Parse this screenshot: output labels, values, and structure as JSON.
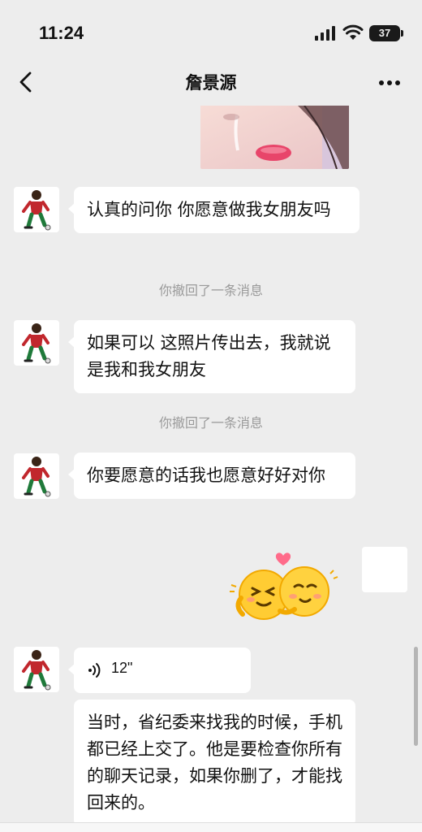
{
  "status_bar": {
    "time": "11:24",
    "battery": "37"
  },
  "nav": {
    "title": "詹景源"
  },
  "messages": [
    {
      "type": "text",
      "text": "认真的问你 你愿意做我女朋友吗"
    },
    {
      "type": "system",
      "text": "你撤回了一条消息"
    },
    {
      "type": "text",
      "text": "如果可以 这照片传出去，我就说是我和我女朋友"
    },
    {
      "type": "system",
      "text": "你撤回了一条消息"
    },
    {
      "type": "text",
      "text": "你要愿意的话我也愿意好好对你"
    },
    {
      "type": "sticker",
      "icon": "hugging-emoji-sticker"
    },
    {
      "type": "voice",
      "duration": "12\""
    },
    {
      "type": "text",
      "text": "当时，省纪委来找我的时候，手机都已经上交了。他是要检查你所有的聊天记录，如果你删了，才能找回来的。"
    }
  ],
  "colors": {
    "background": "#ededed",
    "bubble": "#ffffff",
    "system_text": "#9a9a9a"
  },
  "icons": [
    "back-icon",
    "more-icon",
    "signal-icon",
    "wifi-icon",
    "battery-icon",
    "voice-icon"
  ]
}
